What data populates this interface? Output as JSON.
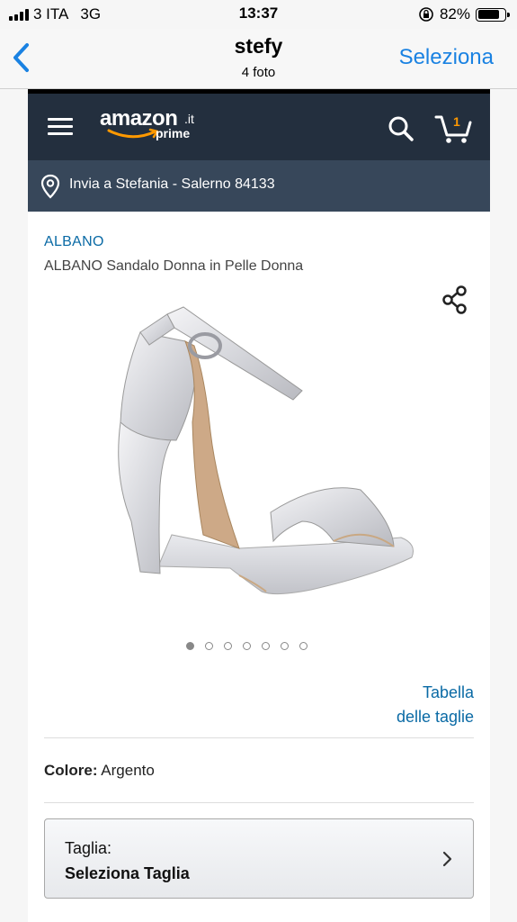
{
  "status_bar": {
    "carrier": "3 ITA",
    "network": "3G",
    "time": "13:37",
    "battery_percent": "82%",
    "battery_level": 0.82
  },
  "nav": {
    "title": "stefy",
    "subtitle": "4 foto",
    "select_label": "Seleziona",
    "back_icon": "chevron-left-icon"
  },
  "amazon": {
    "logo_word": "amazon",
    "logo_tld": ".it",
    "logo_sub": "prime",
    "cart_count": "1",
    "deliver_to": "Invia a Stefania - Salerno 84133"
  },
  "product": {
    "brand": "ALBANO",
    "name": "ALBANO Sandalo Donna in Pelle Donna",
    "image_count": 7,
    "active_image": 1,
    "size_chart_line1": "Tabella",
    "size_chart_line2": "delle taglie",
    "color_label": "Colore:",
    "color_value": "Argento",
    "size_label": "Taglia:",
    "size_value": "Seleziona Taglia"
  },
  "colors": {
    "ios_blue": "#1a82e2",
    "amazon_header": "#232f3e",
    "amazon_subheader": "#37475a",
    "amazon_orange": "#f90",
    "link_blue": "#0a6aa5"
  }
}
